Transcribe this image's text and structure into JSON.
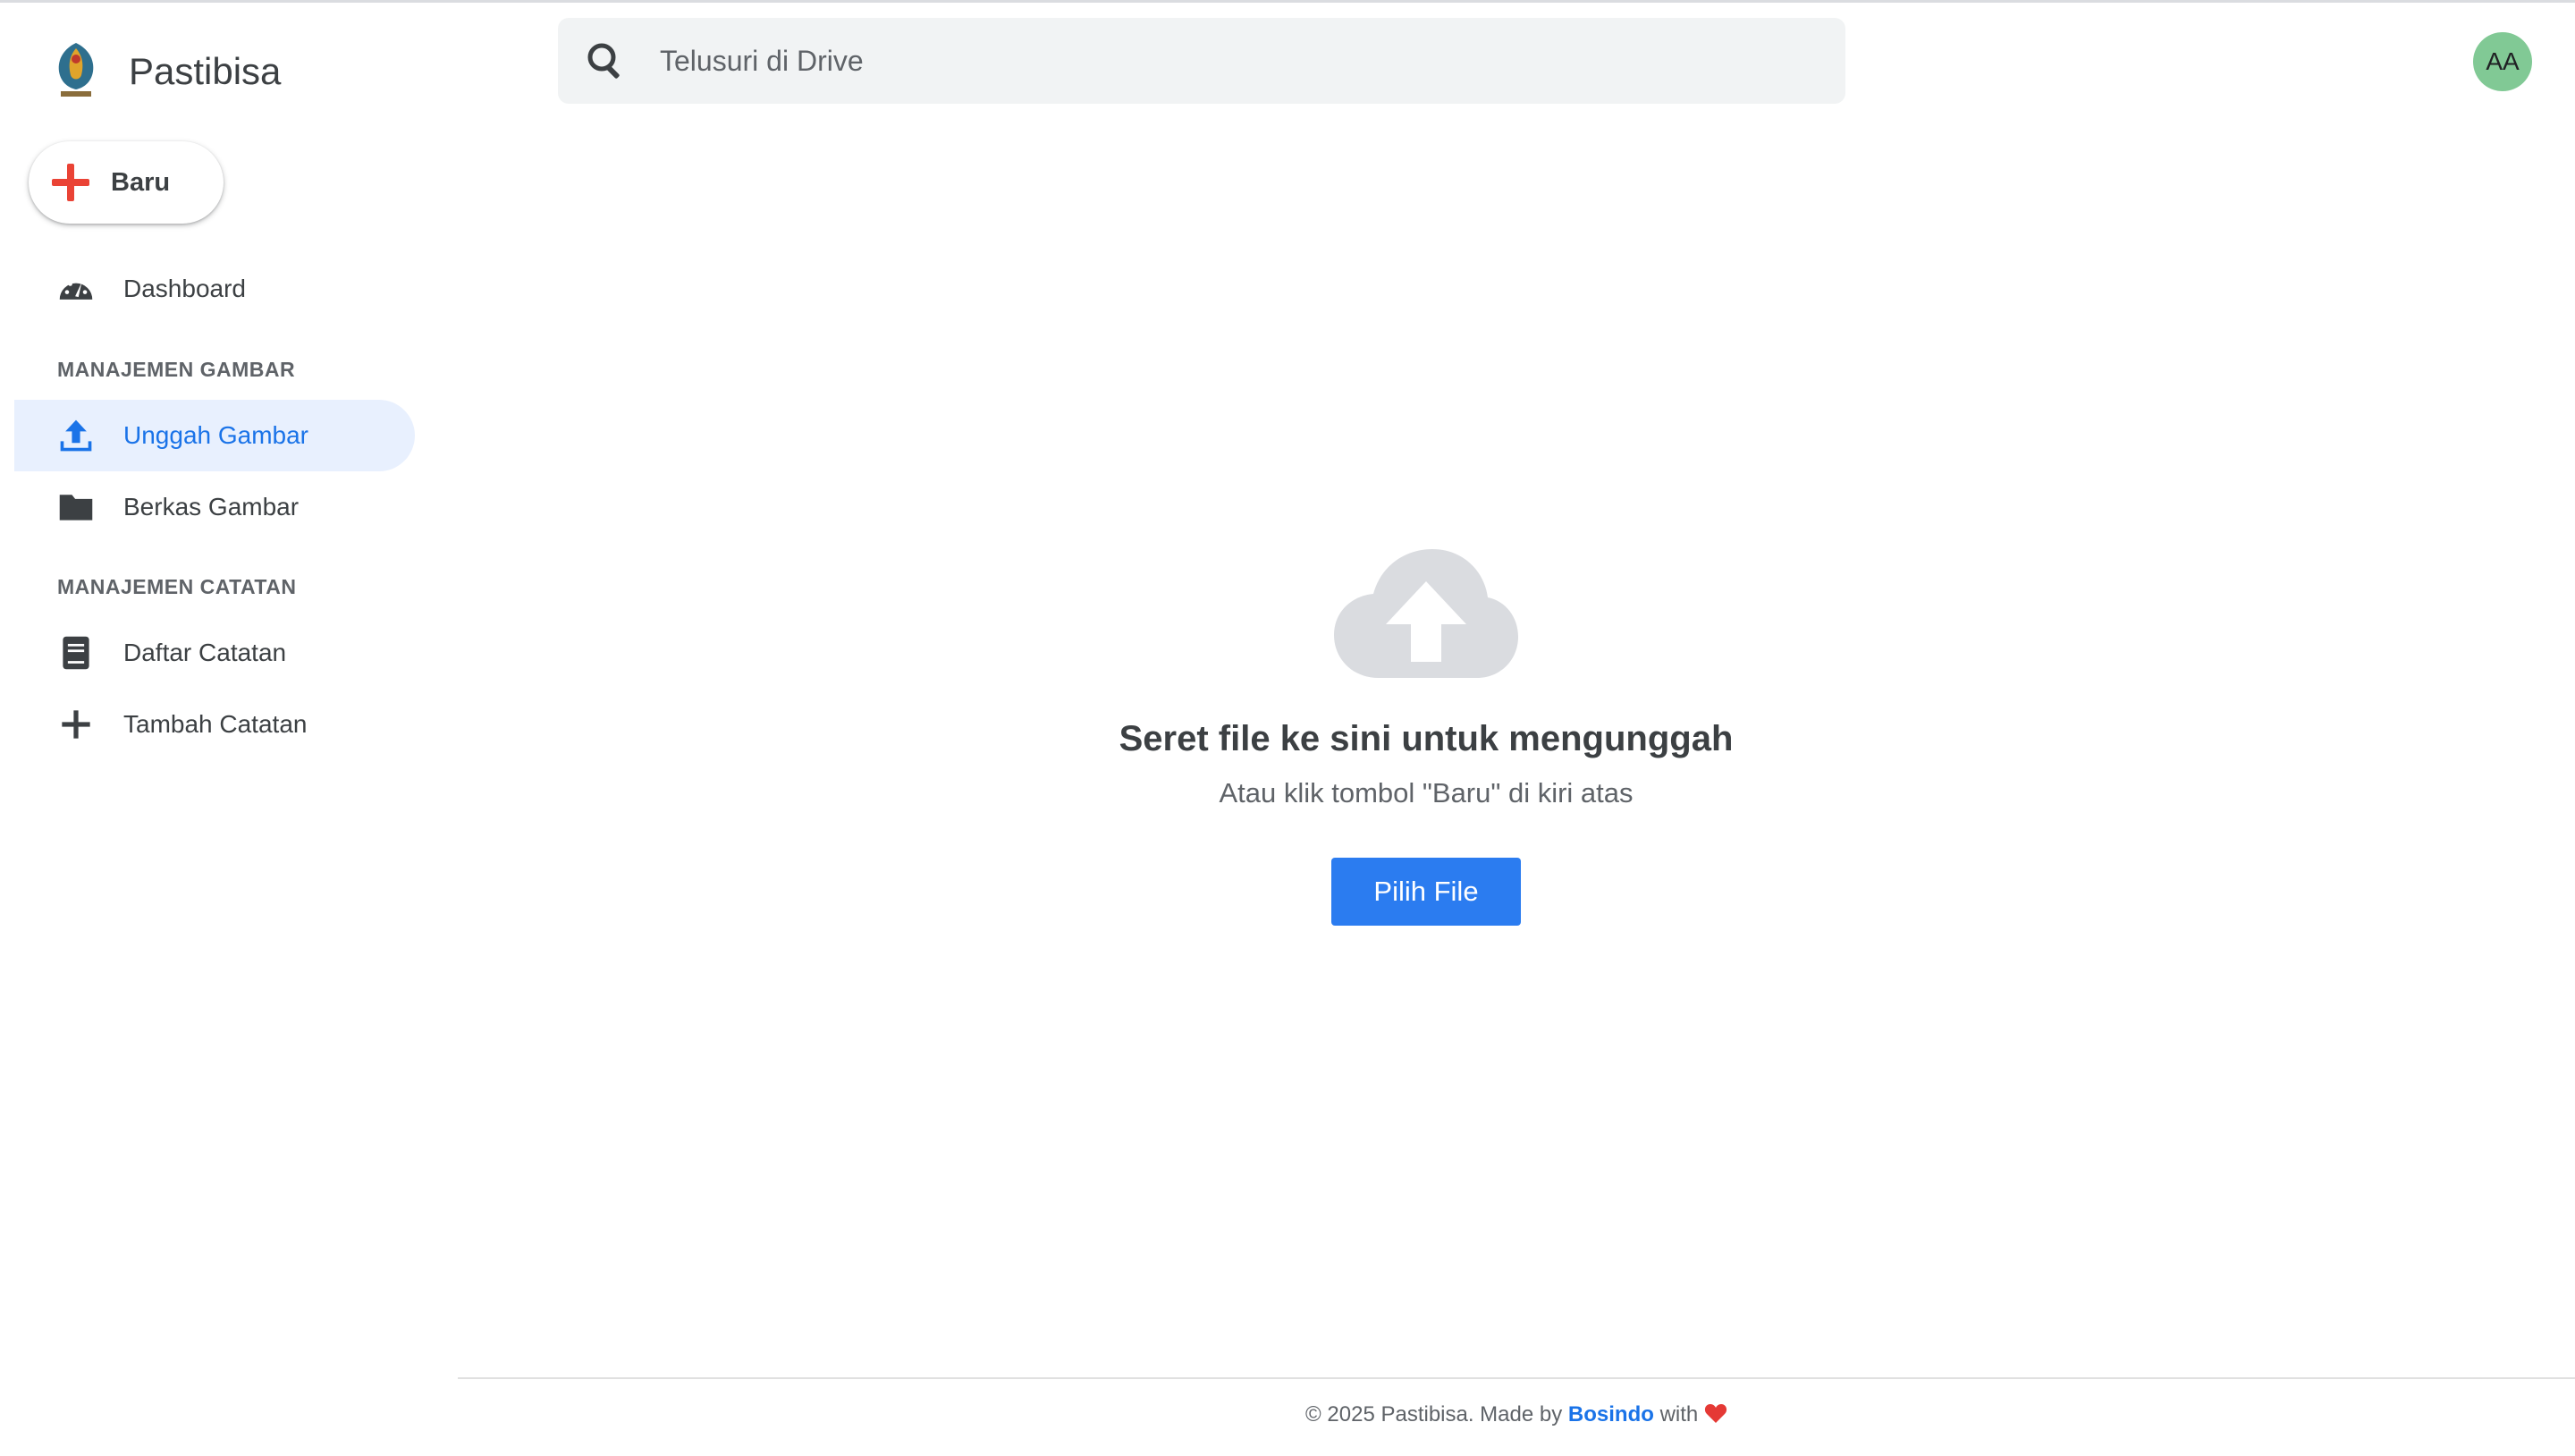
{
  "app": {
    "name": "Pastibisa"
  },
  "sidebar": {
    "new_button": {
      "label": "Baru",
      "icon": "plus-icon"
    },
    "dashboard": {
      "label": "Dashboard",
      "icon": "gauge-icon"
    },
    "sections": [
      {
        "title": "MANAJEMEN GAMBAR",
        "items": [
          {
            "label": "Unggah Gambar",
            "icon": "upload-icon",
            "active": true
          },
          {
            "label": "Berkas Gambar",
            "icon": "folder-icon",
            "active": false
          }
        ]
      },
      {
        "title": "MANAJEMEN CATATAN",
        "items": [
          {
            "label": "Daftar Catatan",
            "icon": "notebook-icon",
            "active": false
          },
          {
            "label": "Tambah Catatan",
            "icon": "plus-icon",
            "active": false
          }
        ]
      }
    ]
  },
  "search": {
    "placeholder": "Telusuri di Drive",
    "value": ""
  },
  "user": {
    "initials": "AA"
  },
  "dropzone": {
    "icon": "cloud-upload-icon",
    "title": "Seret file ke sini untuk mengunggah",
    "subtitle": "Atau klik tombol \"Baru\" di kiri atas",
    "button_label": "Pilih File"
  },
  "footer": {
    "prefix": "© 2025 Pastibisa. Made by",
    "link": "Bosindo",
    "suffix": "with"
  },
  "colors": {
    "accent": "#1a73e8",
    "button": "#2b7cf0",
    "active_bg": "#e8f0fe",
    "avatar": "#81c995",
    "heart": "#e53935",
    "new_plus": "#ea4335"
  }
}
